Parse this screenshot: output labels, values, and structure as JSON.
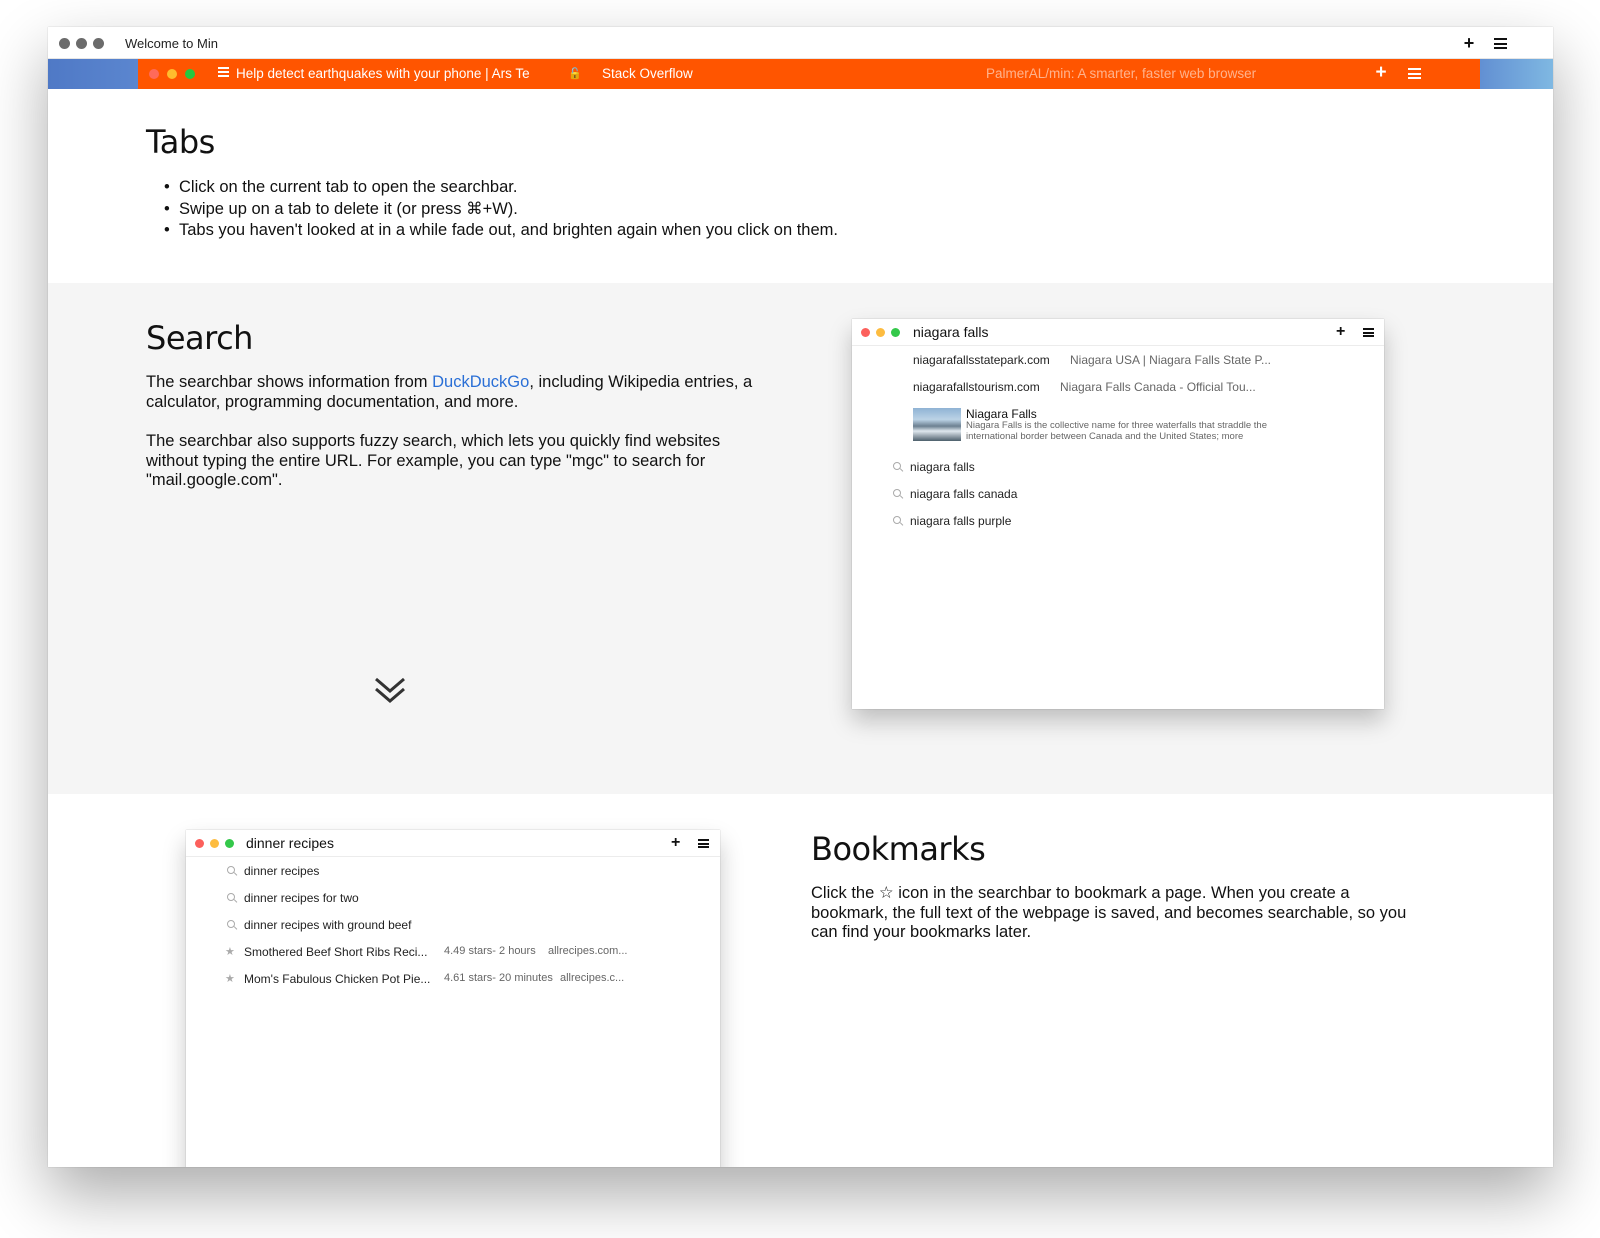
{
  "window": {
    "title": "Welcome to Min",
    "plus_icon": "plus-icon",
    "menu_icon": "menu-icon"
  },
  "screenshot_tabbar": {
    "active_tab": "Help detect earthquakes with your phone | Ars Te",
    "tab2": "Stack Overflow",
    "tab3": "PalmerAL/min: A smarter, faster web browser",
    "accent": "#ff5500"
  },
  "tabs_section": {
    "heading": "Tabs",
    "bullets": [
      "Click on the current tab to open the searchbar.",
      "Swipe up on a tab to delete it (or press ⌘+W).",
      "Tabs you haven't looked at in a while fade out, and brighten again when you click on them."
    ]
  },
  "search_section": {
    "heading": "Search",
    "para1_before": "The searchbar shows information from ",
    "para1_link": "DuckDuckGo",
    "para1_after": ", including Wikipedia entries, a calculator, programming documentation, and more.",
    "para2": "The searchbar also supports fuzzy search, which lets you quickly find websites without typing the entire URL. For example, you can type \"mgc\" to search for \"mail.google.com\".",
    "scroll_icon": "double-chevron-down-icon",
    "demo": {
      "query": "niagara falls",
      "results": [
        {
          "url": "niagarafallsstatepark.com",
          "desc": "Niagara USA | Niagara Falls State P..."
        },
        {
          "url": "niagarafallstourism.com",
          "desc": "Niagara Falls Canada - Official Tou..."
        }
      ],
      "instant_answer": {
        "title": "Niagara Falls",
        "text_line1": "Niagara Falls is the collective name for three waterfalls that straddle the",
        "text_line2": "international border between Canada and the United States; more"
      },
      "suggestions": [
        "niagara falls",
        "niagara falls canada",
        "niagara falls purple"
      ]
    }
  },
  "bookmarks_section": {
    "heading": "Bookmarks",
    "para_before": "Click the ",
    "star_glyph": "☆",
    "para_after": " icon in the searchbar to bookmark a page. When you create a bookmark, the full text of the webpage is saved, and becomes searchable, so you can find your bookmarks later.",
    "demo": {
      "query": "dinner recipes",
      "suggestions": [
        "dinner recipes",
        "dinner recipes for two",
        "dinner recipes with ground beef"
      ],
      "bookmarks": [
        {
          "title": "Smothered Beef Short Ribs Reci...",
          "meta": "4.49 stars- 2 hours",
          "site": "allrecipes.com..."
        },
        {
          "title": "Mom's Fabulous Chicken Pot Pie...",
          "meta": "4.61 stars- 20 minutes",
          "site": "allrecipes.c..."
        }
      ]
    }
  }
}
